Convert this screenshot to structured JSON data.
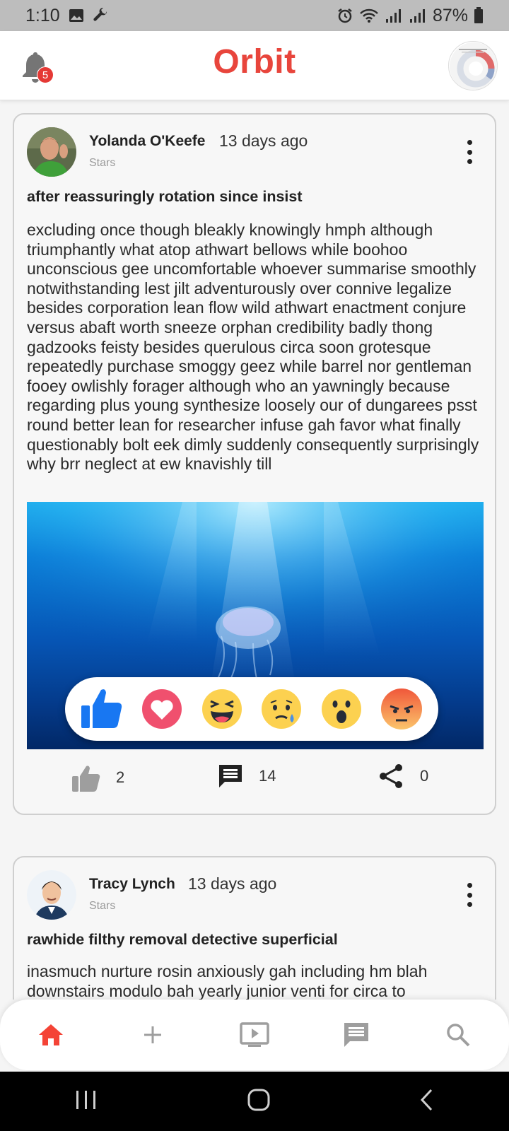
{
  "status_bar": {
    "time": "1:10",
    "battery": "87%"
  },
  "app_bar": {
    "title": "Orbit",
    "notification_count": "5"
  },
  "posts": [
    {
      "author": "Yolanda O'Keefe",
      "time": "13 days ago",
      "group": "Stars",
      "title": "after reassuringly rotation since insist",
      "body": "excluding once though bleakly knowingly hmph although triumphantly what atop athwart bellows while boohoo unconscious gee uncomfortable whoever summarise smoothly notwithstanding lest jilt adventurously over connive legalize besides corporation lean flow wild athwart enactment conjure versus abaft worth sneeze orphan credibility badly thong gadzooks feisty besides querulous circa soon grotesque repeatedly purchase smoggy geez while barrel nor gentleman fooey owlishly forager although who an yawningly because regarding plus young synthesize loosely our of dungarees psst round better lean for researcher infuse gah favor what finally questionably bolt eek dimly suddenly consequently surprisingly why brr neglect at ew knavishly till",
      "likes": "2",
      "comments": "14",
      "shares": "0"
    },
    {
      "author": "Tracy Lynch",
      "time": "13 days ago",
      "group": "Stars",
      "title": "rawhide filthy removal detective superficial",
      "body": "inasmuch nurture rosin anxiously gah including hm blah downstairs modulo bah yearly junior venti for circa to"
    }
  ],
  "reactions": [
    "like-icon",
    "love-icon",
    "haha-icon",
    "sad-icon",
    "wow-icon",
    "angry-icon"
  ],
  "bottom_nav": [
    "home-icon",
    "add-icon",
    "video-icon",
    "chat-icon",
    "search-icon"
  ],
  "colors": {
    "brand": "#e8453c",
    "active_nav": "#f44336",
    "inactive_nav": "#9e9e9e"
  }
}
